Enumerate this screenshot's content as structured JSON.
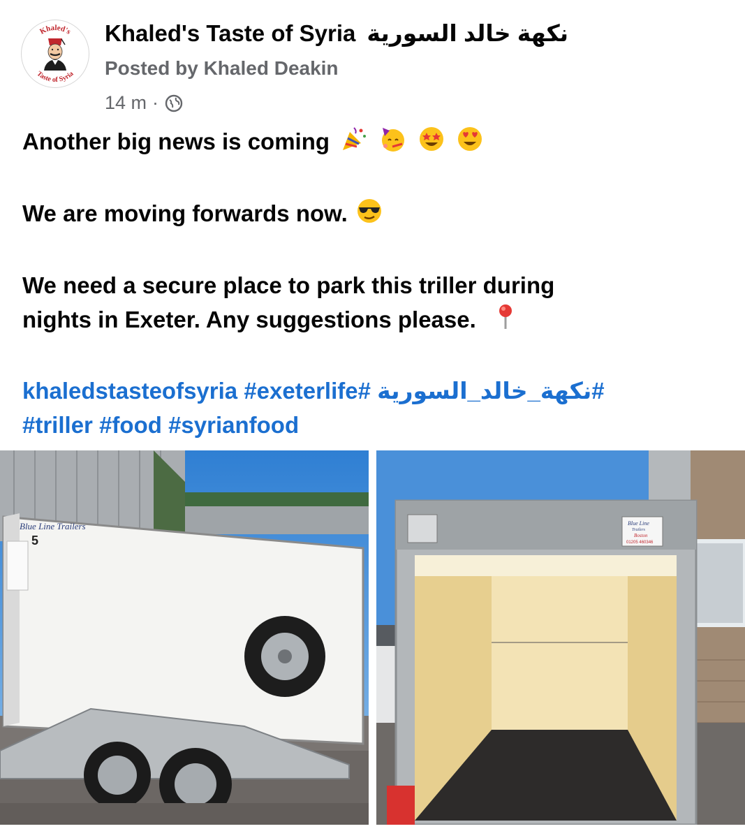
{
  "post": {
    "page_name": "Khaled's Taste of Syria",
    "page_name_ar": "نكهة خالد السورية",
    "avatar_text_top": "Khaled's",
    "avatar_text_bottom": "Taste of Syria",
    "posted_by": "Posted by Khaled Deakin",
    "timestamp": "14 m",
    "separator": "·",
    "privacy_icon": "globe-icon",
    "text": {
      "line1": "Another big news is coming",
      "line2": "We are moving forwards now.",
      "line3a": "We need a secure place to park this triller during",
      "line3b": "nights in Exeter. Any suggestions please."
    },
    "hashtags": {
      "tag1": "khaledstasteofsyria",
      "tag2": "#exeterlife#",
      "tag3": "#نكهة_خالد_السورية",
      "tag4": "#triller",
      "tag5": "#food",
      "tag6": "#syrianfood"
    },
    "photos": {
      "left_brand": "Blue Line Trailers",
      "left_number": "5",
      "right_brand": "Blue Line",
      "right_brand2": "Trailers",
      "right_city": "Boston",
      "right_phone": "01205 460346"
    },
    "colors": {
      "hashtag": "#1b6fd0",
      "secondary_text": "#65676b",
      "primary_text": "#050505"
    }
  }
}
